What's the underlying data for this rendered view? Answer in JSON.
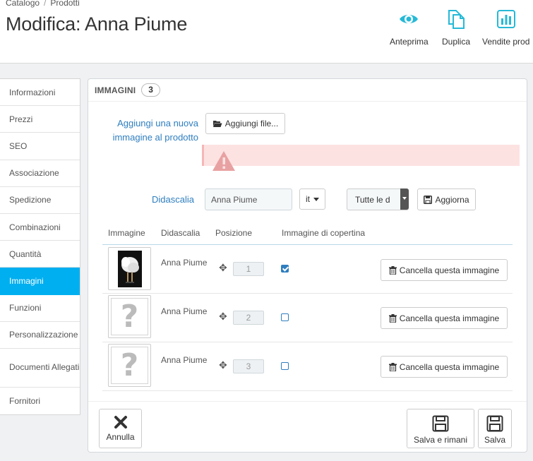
{
  "breadcrumb": {
    "first": "Catalogo",
    "separator": "/",
    "second": "Prodotti"
  },
  "page_title": "Modifica: Anna Piume",
  "toolbar": {
    "preview": {
      "label": "Anteprima",
      "icon": "eye-icon"
    },
    "duplicate": {
      "label": "Duplica",
      "icon": "copy-icon"
    },
    "sales": {
      "label": "Vendite prod",
      "icon": "bar-chart-icon"
    }
  },
  "sidebar": {
    "items": [
      {
        "label": "Informazioni"
      },
      {
        "label": "Prezzi"
      },
      {
        "label": "SEO"
      },
      {
        "label": "Associazione"
      },
      {
        "label": "Spedizione"
      },
      {
        "label": "Combinazioni"
      },
      {
        "label": "Quantità"
      },
      {
        "label": "Immagini"
      },
      {
        "label": "Funzioni"
      },
      {
        "label": "Personalizzazione"
      },
      {
        "label": "Documenti Allegati"
      },
      {
        "label": "Fornitori"
      }
    ],
    "active_index": 7
  },
  "panel": {
    "heading": "IMMAGINI",
    "count": "3",
    "add_image_label": "Aggiungi una nuova immagine al prodotto",
    "add_file_button": "Aggiungi file...",
    "caption_label": "Didascalia",
    "caption_value": "Anna Piume",
    "lang_select": "it",
    "shops_select": "Tutte le d",
    "update_button": "Aggiorna",
    "columns": {
      "image": "Immagine",
      "caption": "Didascalia",
      "position": "Posizione",
      "cover": "Immagine di copertina"
    },
    "rows": [
      {
        "caption": "Anna Piume",
        "position": "1",
        "cover": true,
        "thumb": "photo",
        "delete_label": "Cancella questa immagine"
      },
      {
        "caption": "Anna Piume",
        "position": "2",
        "cover": false,
        "thumb": "placeholder",
        "delete_label": "Cancella questa immagine"
      },
      {
        "caption": "Anna Piume",
        "position": "3",
        "cover": false,
        "thumb": "placeholder",
        "delete_label": "Cancella questa immagine"
      }
    ],
    "placeholder_glyph": "?",
    "move_glyph": "✥",
    "footer": {
      "cancel": "Annulla",
      "save_stay": "Salva e rimani",
      "save": "Salva"
    }
  },
  "colors": {
    "accent": "#00aff0",
    "link": "#2e7ebf",
    "alert_bg": "#fde2e2"
  }
}
